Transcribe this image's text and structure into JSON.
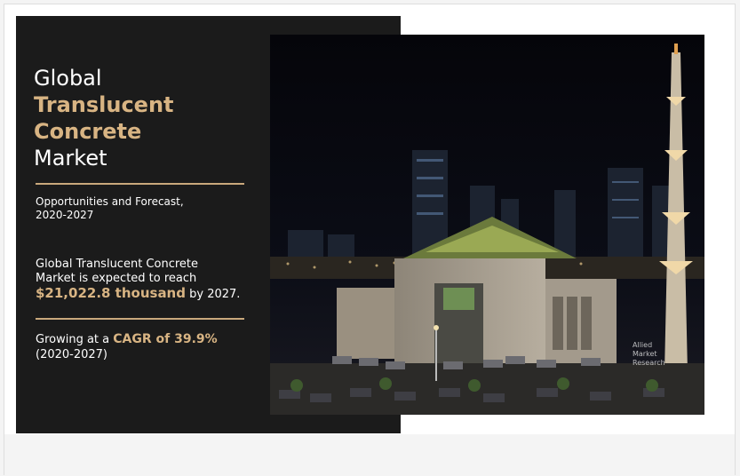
{
  "infographic": {
    "title_line1": "Global",
    "title_line2": "Translucent",
    "title_line3": "Concrete",
    "title_line4": "Market",
    "subtitle_line1": "Opportunities and Forecast,",
    "subtitle_line2": "2020-2027",
    "stat_text_1": "Global Translucent Concrete",
    "stat_text_2": "Market is expected to reach",
    "stat_value": "$21,022.8 thousand",
    "stat_suffix": " by 2027.",
    "cagr_prefix": "Growing at a ",
    "cagr_value": "CAGR of 39.9%",
    "cagr_period": "(2020-2027)"
  },
  "photo": {
    "subject": "night-city-mosque-photo",
    "watermark_line1": "Allied",
    "watermark_line2": "Market",
    "watermark_line3": "Research"
  },
  "colors": {
    "panel": "#1b1b1b",
    "accent": "#d8b483",
    "rule": "#c9a87c",
    "background": "#f4f4f4"
  }
}
